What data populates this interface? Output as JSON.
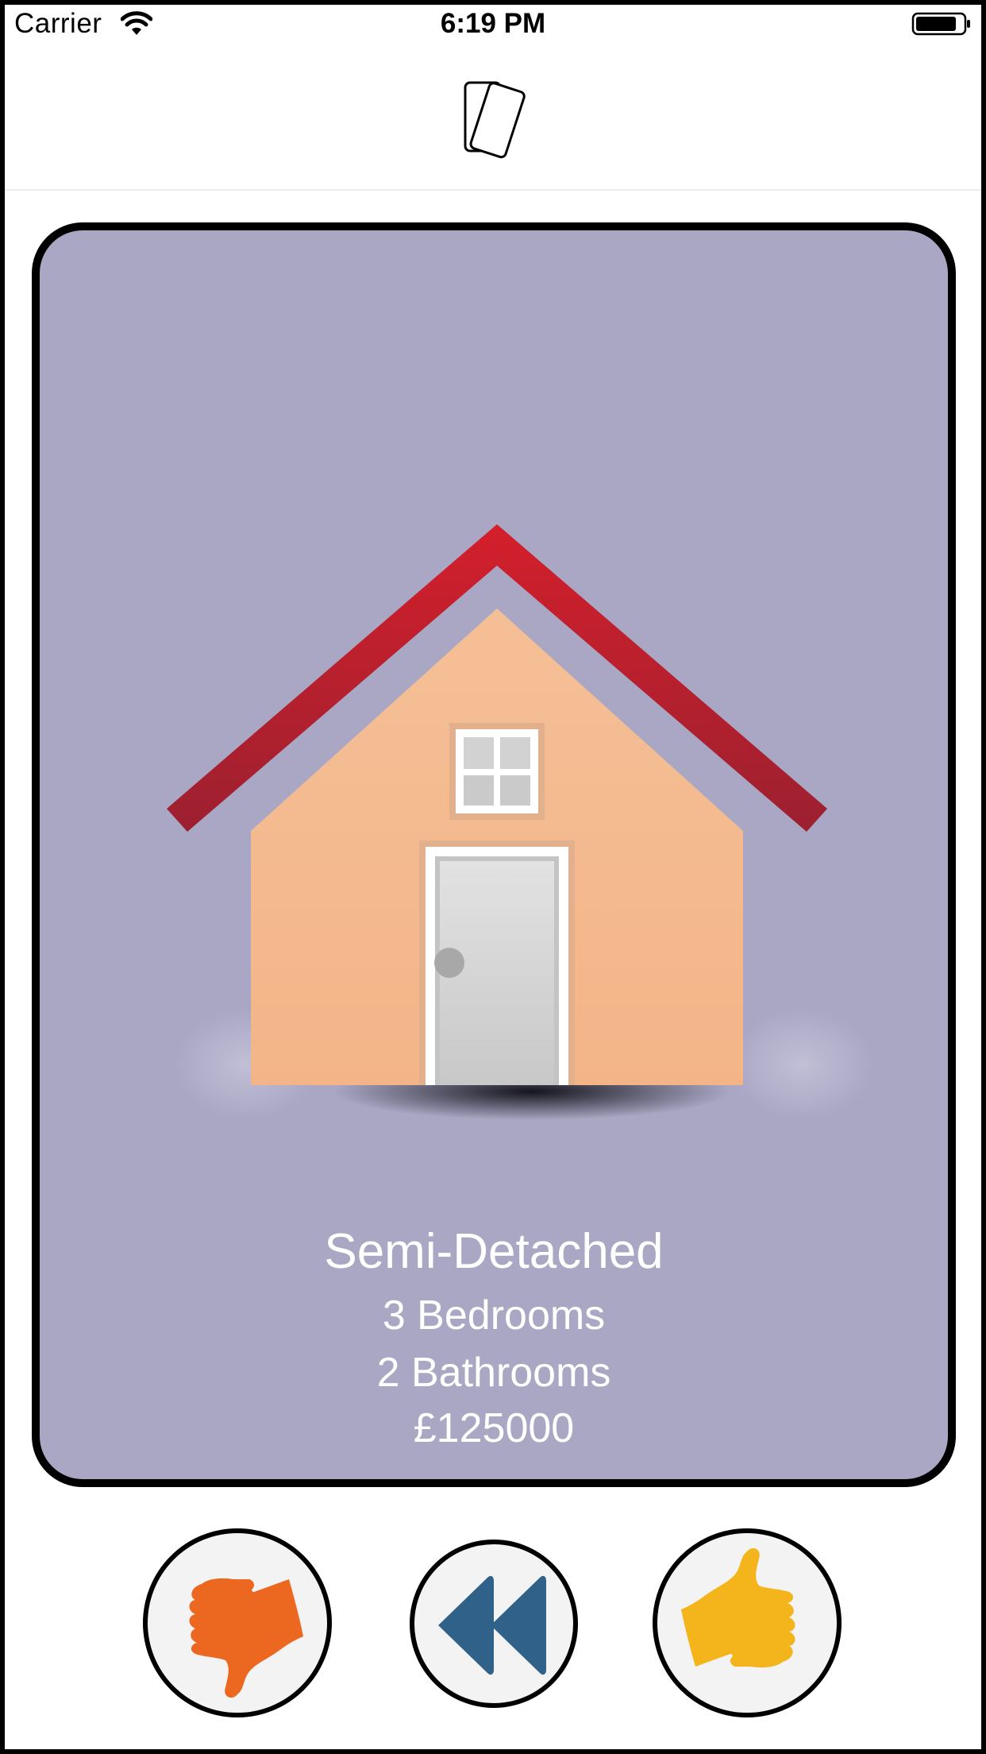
{
  "status_bar": {
    "carrier": "Carrier",
    "time": "6:19 PM",
    "wifi_icon": "wifi-icon",
    "battery_icon": "battery-icon"
  },
  "nav_bar": {
    "logo_icon": "cards-icon"
  },
  "property": {
    "type": "Semi-Detached",
    "bedrooms": "3 Bedrooms",
    "bathrooms": "2 Bathrooms",
    "price": "£125000",
    "image_icon": "house-icon",
    "card_color": "#a9a7c4"
  },
  "actions": {
    "dislike": {
      "icon": "thumbs-down-icon",
      "color": "#ec671f"
    },
    "rewind": {
      "icon": "rewind-icon",
      "color": "#2f6189"
    },
    "like": {
      "icon": "thumbs-up-icon",
      "color": "#f4b51c"
    }
  }
}
